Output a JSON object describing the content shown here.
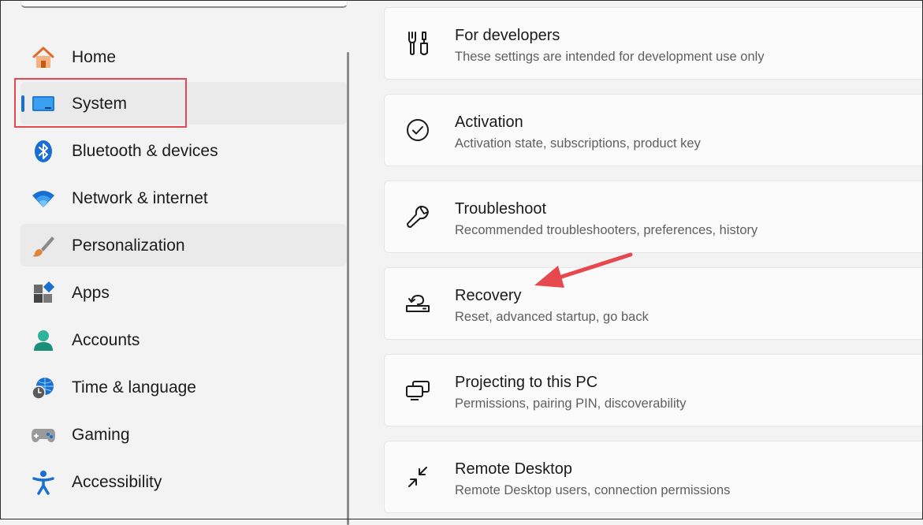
{
  "sidebar": {
    "items": [
      {
        "label": "Home",
        "icon": "home-icon"
      },
      {
        "label": "System",
        "icon": "system-icon"
      },
      {
        "label": "Bluetooth & devices",
        "icon": "bluetooth-icon"
      },
      {
        "label": "Network & internet",
        "icon": "wifi-icon"
      },
      {
        "label": "Personalization",
        "icon": "paintbrush-icon"
      },
      {
        "label": "Apps",
        "icon": "apps-icon"
      },
      {
        "label": "Accounts",
        "icon": "person-icon"
      },
      {
        "label": "Time & language",
        "icon": "globe-clock-icon"
      },
      {
        "label": "Gaming",
        "icon": "gamepad-icon"
      },
      {
        "label": "Accessibility",
        "icon": "accessibility-icon"
      }
    ],
    "selected": "System"
  },
  "main": {
    "cards": [
      {
        "title": "For developers",
        "subtitle": "These settings are intended for development use only",
        "icon": "developer-tools-icon"
      },
      {
        "title": "Activation",
        "subtitle": "Activation state, subscriptions, product key",
        "icon": "check-circle-icon"
      },
      {
        "title": "Troubleshoot",
        "subtitle": "Recommended troubleshooters, preferences, history",
        "icon": "wrench-icon"
      },
      {
        "title": "Recovery",
        "subtitle": "Reset, advanced startup, go back",
        "icon": "recovery-icon"
      },
      {
        "title": "Projecting to this PC",
        "subtitle": "Permissions, pairing PIN, discoverability",
        "icon": "projecting-icon"
      },
      {
        "title": "Remote Desktop",
        "subtitle": "Remote Desktop users, connection permissions",
        "icon": "remote-desktop-icon"
      }
    ]
  },
  "colors": {
    "accent": "#1a6fd1",
    "annotation": "#e5484d"
  }
}
